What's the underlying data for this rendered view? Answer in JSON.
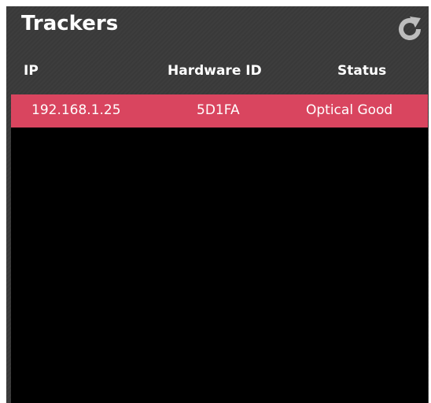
{
  "panel": {
    "title": "Trackers",
    "refresh_icon": "refresh-icon"
  },
  "table": {
    "columns": [
      "IP",
      "Hardware ID",
      "Status"
    ],
    "rows": [
      {
        "ip": "192.168.1.25",
        "hardware_id": "5D1FA",
        "status": "Optical Good",
        "selected": true
      }
    ]
  },
  "colors": {
    "panel_bg": "#3a3a3a",
    "list_bg": "#000000",
    "selected_row": "#d9455f",
    "text": "#ffffff",
    "icon": "#bdbdbd"
  }
}
